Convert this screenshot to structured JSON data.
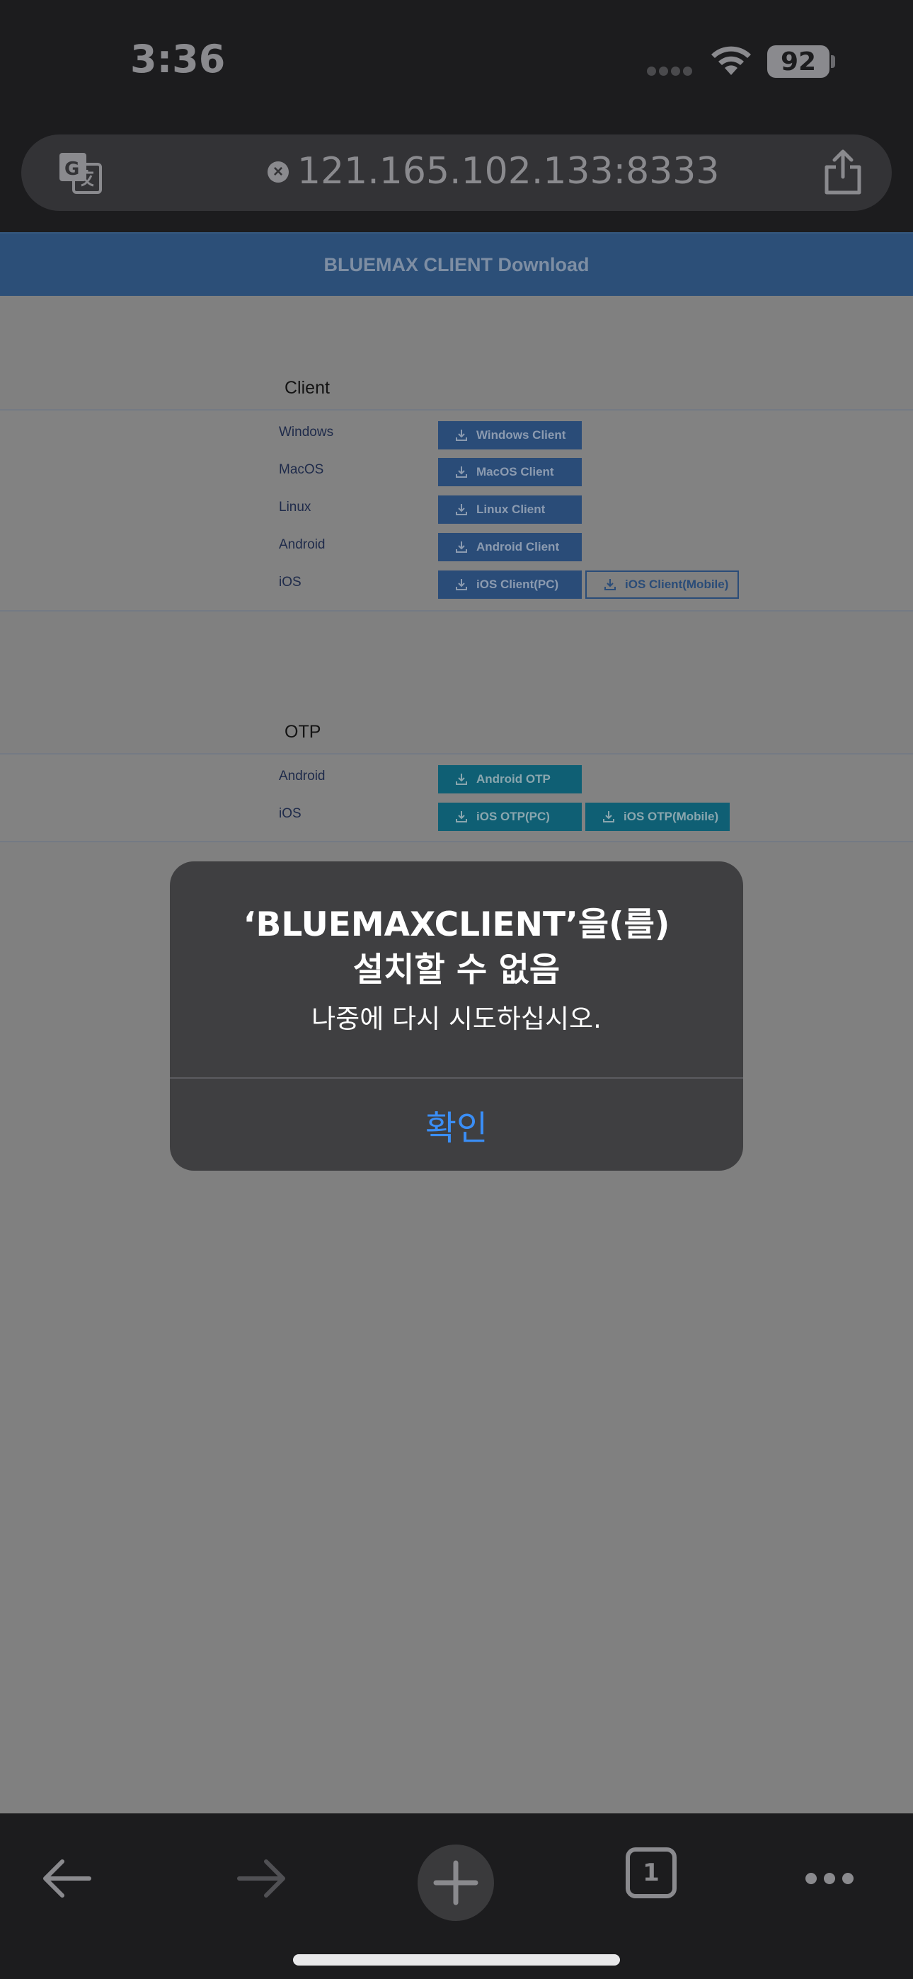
{
  "status_bar": {
    "time": "3:36",
    "battery": "92"
  },
  "browser": {
    "url": "121.165.102.133:8333"
  },
  "page": {
    "header_title": "BLUEMAX CLIENT Download",
    "client_section": {
      "title": "Client",
      "rows": [
        {
          "label": "Windows",
          "buttons": [
            "Windows Client"
          ]
        },
        {
          "label": "MacOS",
          "buttons": [
            "MacOS Client"
          ]
        },
        {
          "label": "Linux",
          "buttons": [
            "Linux Client"
          ]
        },
        {
          "label": "Android",
          "buttons": [
            "Android Client"
          ]
        },
        {
          "label": "iOS",
          "buttons": [
            "iOS Client(PC)",
            "iOS Client(Mobile)"
          ]
        }
      ]
    },
    "otp_section": {
      "title": "OTP",
      "rows": [
        {
          "label": "Android",
          "buttons": [
            "Android OTP"
          ]
        },
        {
          "label": "iOS",
          "buttons": [
            "iOS OTP(PC)",
            "iOS OTP(Mobile)"
          ]
        }
      ]
    }
  },
  "alert": {
    "title_line1": "‘BLUEMAXCLIENT’을(를)",
    "title_line2": "설치할 수 없음",
    "message": "나중에 다시 시도하십시오.",
    "confirm_label": "확인"
  },
  "toolbar": {
    "tab_count": "1"
  },
  "colors": {
    "accent": "#3a8ef6",
    "header_blue": "#2c4f78",
    "otp_teal": "#0f5f74"
  }
}
